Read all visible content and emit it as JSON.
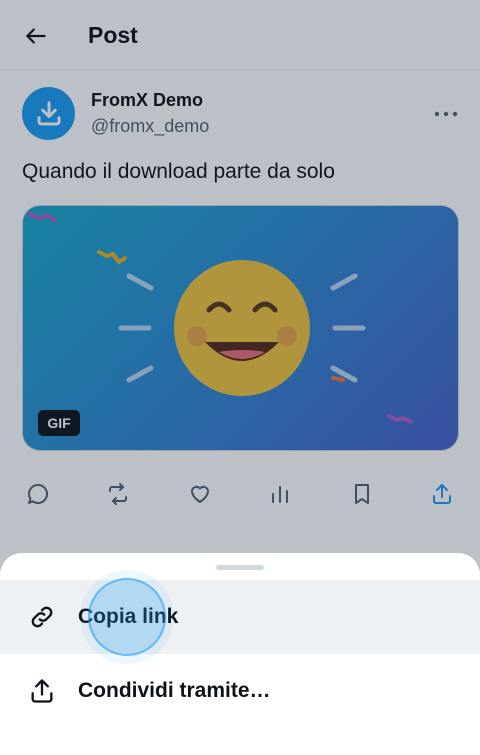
{
  "header": {
    "title": "Post"
  },
  "author": {
    "name": "FromX Demo",
    "handle": "@fromx_demo"
  },
  "post": {
    "text": "Quando il download parte da solo"
  },
  "media": {
    "badge": "GIF"
  },
  "icons": {
    "back": "back-arrow-icon",
    "more": "more-horizontal-icon",
    "reply": "reply-icon",
    "repost": "repost-icon",
    "like": "heart-icon",
    "views": "views-icon",
    "bookmark": "bookmark-icon",
    "share": "share-icon",
    "link": "link-icon"
  },
  "colors": {
    "accent": "#1d9bf0",
    "text": "#0f1419",
    "muted": "#536471"
  },
  "share_sheet": {
    "items": [
      {
        "label": "Copia link"
      },
      {
        "label": "Condividi tramite…"
      }
    ]
  }
}
